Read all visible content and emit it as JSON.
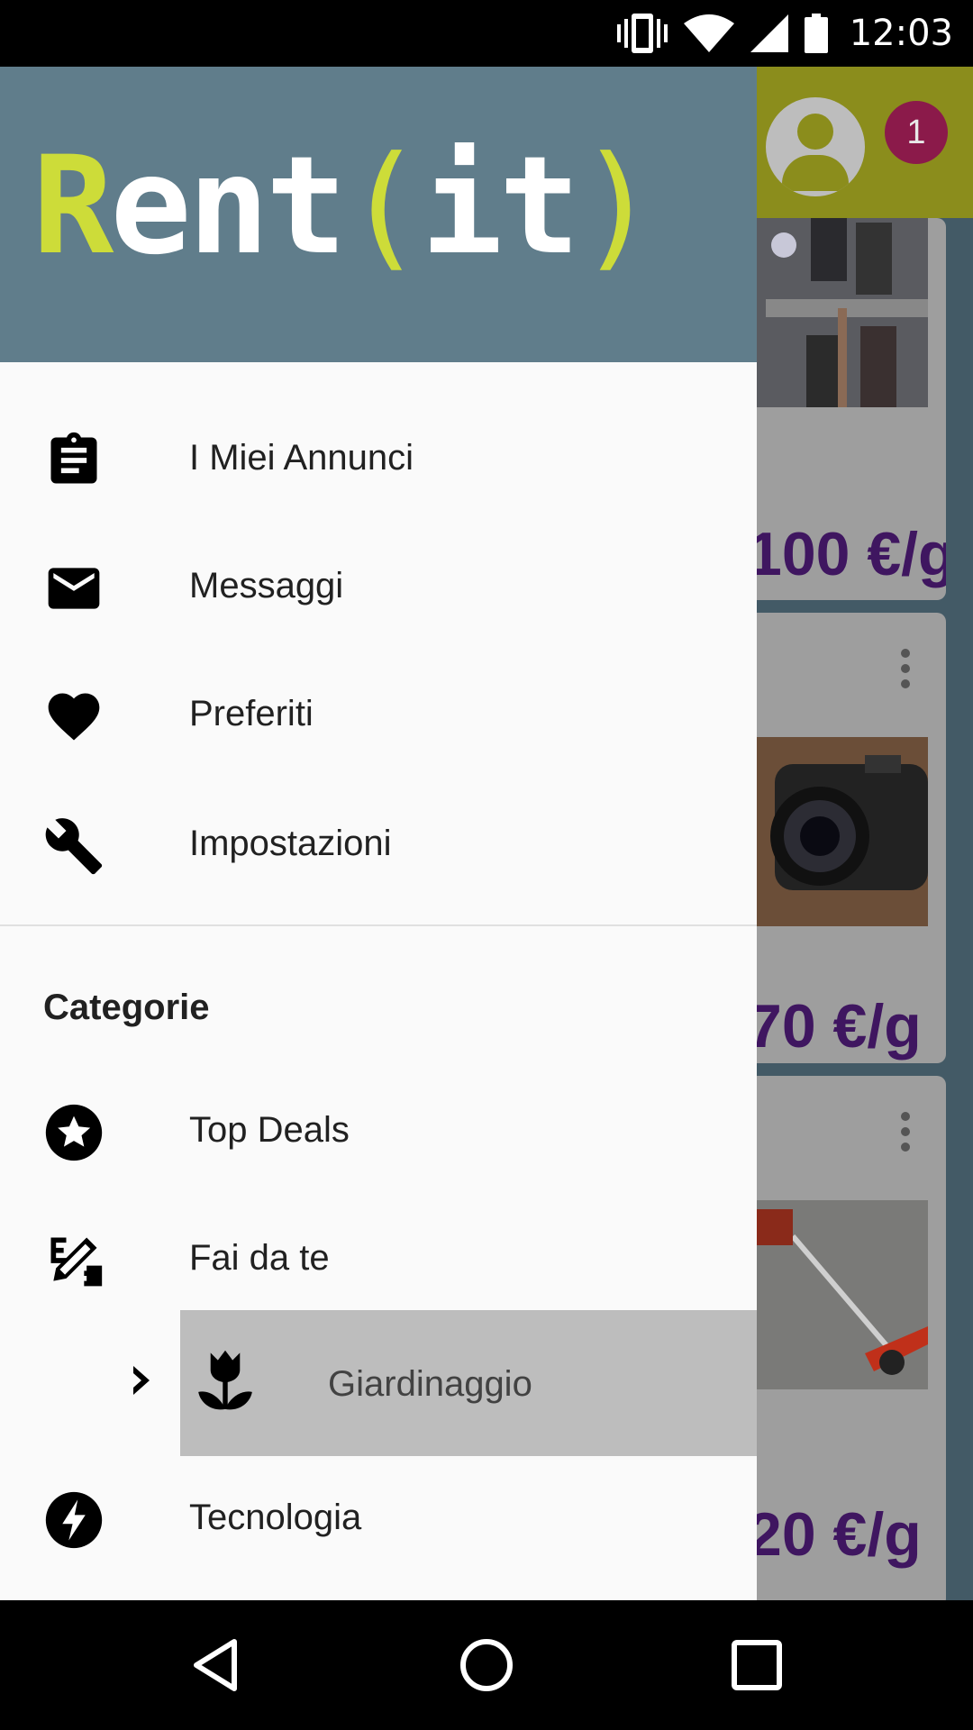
{
  "status_bar": {
    "time": "12:03",
    "icons": [
      "vibrate-icon",
      "wifi-icon",
      "cell-signal-icon",
      "battery-icon"
    ]
  },
  "background_app": {
    "notification_count": "1",
    "cards": [
      {
        "price": "100 €/g",
        "image": "dj-audio-equipment"
      },
      {
        "price": "70 €/g",
        "image": "camera"
      },
      {
        "price": "20 €/g",
        "image": "brush-cutter"
      }
    ]
  },
  "drawer": {
    "logo": {
      "r": "R",
      "ent": "ent",
      "open": "(",
      "it": "it",
      "close": ")"
    },
    "items": [
      {
        "label": "I Miei Annunci",
        "icon": "clipboard-icon"
      },
      {
        "label": "Messaggi",
        "icon": "mail-icon"
      },
      {
        "label": "Preferiti",
        "icon": "heart-icon"
      },
      {
        "label": "Impostazioni",
        "icon": "wrench-icon"
      }
    ],
    "section_title": "Categorie",
    "categories": [
      {
        "label": "Top Deals",
        "icon": "star-icon"
      },
      {
        "label": "Fai da te",
        "icon": "pencil-ruler-icon"
      },
      {
        "label": "Giardinaggio",
        "icon": "flower-icon",
        "selected": true
      },
      {
        "label": "Tecnologia",
        "icon": "lightning-icon"
      }
    ]
  },
  "nav_bar": {
    "buttons": [
      "back-icon",
      "home-icon",
      "recents-icon"
    ]
  },
  "colors": {
    "header": "#607d8b",
    "logo_accent": "#cddc39",
    "selected_bg": "#bdbdbd",
    "price": "#3f1660"
  }
}
